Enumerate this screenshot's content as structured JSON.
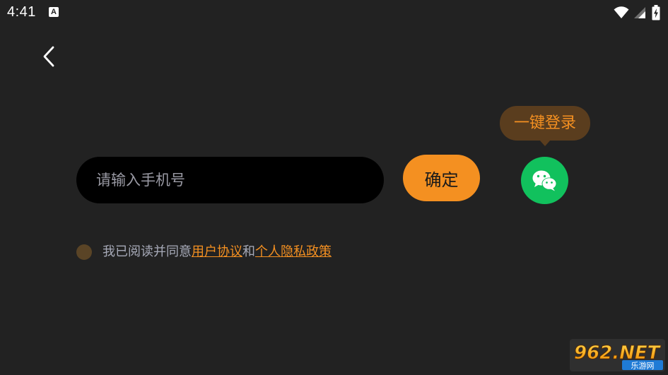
{
  "status_bar": {
    "time": "4:41",
    "notification_icon": "A"
  },
  "login": {
    "phone_placeholder": "请输入手机号",
    "phone_value": "",
    "confirm_label": "确定",
    "tooltip_label": "一键登录",
    "wechat_icon": "wechat-icon"
  },
  "agreement": {
    "prefix": "我已阅读并同意",
    "user_agreement": "用户协议",
    "conjunction": "和",
    "privacy_policy": "个人隐私政策",
    "checked": false
  },
  "watermark": {
    "main": "962.NET",
    "sub": "乐游网"
  },
  "colors": {
    "background": "#222222",
    "accent": "#f49021",
    "input_bg": "#000000",
    "wechat_green": "#11c15d",
    "tooltip_bg": "#5a3d1e",
    "secondary_text": "#a7aab8"
  }
}
